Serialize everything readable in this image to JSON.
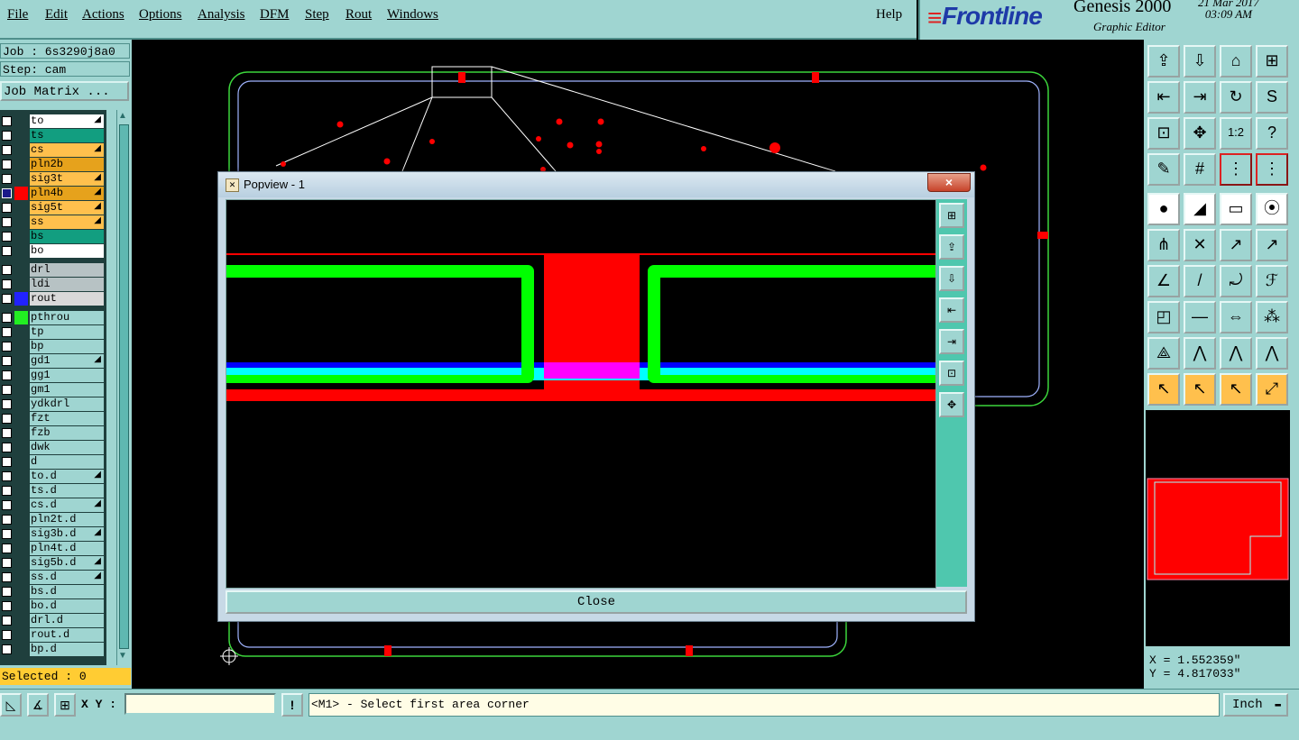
{
  "menu": {
    "items": [
      "File",
      "Edit",
      "Actions",
      "Options",
      "Analysis",
      "DFM",
      "Step",
      "Rout",
      "Windows"
    ],
    "help": "Help"
  },
  "brand": {
    "logo": "Frontline",
    "product": "Genesis 2000",
    "subtitle": "Graphic Editor",
    "date": "21 Mar 2017",
    "time": "03:09 AM"
  },
  "job": {
    "job_line": "Job : 6s3290j8a0",
    "step_line": "Step: cam",
    "matrix_button": "Job Matrix ..."
  },
  "layers": [
    {
      "name": "to",
      "bg": "#ffffff",
      "swatch": "",
      "mark": true,
      "checked": false
    },
    {
      "name": "ts",
      "bg": "#129e80",
      "swatch": "",
      "mark": false,
      "checked": false
    },
    {
      "name": "cs",
      "bg": "#ffc04d",
      "swatch": "",
      "mark": true,
      "checked": false
    },
    {
      "name": "pln2b",
      "bg": "#e6a21c",
      "swatch": "",
      "mark": false,
      "checked": false
    },
    {
      "name": "sig3t",
      "bg": "#ffc04d",
      "swatch": "",
      "mark": true,
      "checked": false
    },
    {
      "name": "pln4b",
      "bg": "#e6a21c",
      "swatch": "#ff0000",
      "mark": true,
      "checked": true
    },
    {
      "name": "sig5t",
      "bg": "#ffc04d",
      "swatch": "",
      "mark": true,
      "checked": false
    },
    {
      "name": "ss",
      "bg": "#ffc04d",
      "swatch": "",
      "mark": true,
      "checked": false
    },
    {
      "name": "bs",
      "bg": "#129e80",
      "swatch": "",
      "mark": false,
      "checked": false
    },
    {
      "name": "bo",
      "bg": "#ffffff",
      "swatch": "",
      "mark": false,
      "checked": false
    },
    {
      "name": "drl",
      "bg": "#b7c2c4",
      "swatch": "",
      "mark": false,
      "checked": false,
      "gap": true
    },
    {
      "name": "ldi",
      "bg": "#b7c2c4",
      "swatch": "",
      "mark": false,
      "checked": false
    },
    {
      "name": "rout",
      "bg": "#d9d9d9",
      "swatch": "#2222ff",
      "mark": false,
      "checked": false
    },
    {
      "name": "pthrou",
      "bg": "#9fd5d1",
      "swatch": "#22ee22",
      "mark": false,
      "checked": false,
      "gap": true
    },
    {
      "name": "tp",
      "bg": "#9fd5d1",
      "swatch": "",
      "mark": false,
      "checked": false
    },
    {
      "name": "bp",
      "bg": "#9fd5d1",
      "swatch": "",
      "mark": false,
      "checked": false
    },
    {
      "name": "gd1",
      "bg": "#9fd5d1",
      "swatch": "",
      "mark": true,
      "checked": false
    },
    {
      "name": "gg1",
      "bg": "#9fd5d1",
      "swatch": "",
      "mark": false,
      "checked": false
    },
    {
      "name": "gm1",
      "bg": "#9fd5d1",
      "swatch": "",
      "mark": false,
      "checked": false
    },
    {
      "name": "ydkdrl",
      "bg": "#9fd5d1",
      "swatch": "",
      "mark": false,
      "checked": false
    },
    {
      "name": "fzt",
      "bg": "#9fd5d1",
      "swatch": "",
      "mark": false,
      "checked": false
    },
    {
      "name": "fzb",
      "bg": "#9fd5d1",
      "swatch": "",
      "mark": false,
      "checked": false
    },
    {
      "name": "dwk",
      "bg": "#9fd5d1",
      "swatch": "",
      "mark": false,
      "checked": false
    },
    {
      "name": "d",
      "bg": "#9fd5d1",
      "swatch": "",
      "mark": false,
      "checked": false
    },
    {
      "name": "to.d",
      "bg": "#9fd5d1",
      "swatch": "",
      "mark": true,
      "checked": false
    },
    {
      "name": "ts.d",
      "bg": "#9fd5d1",
      "swatch": "",
      "mark": false,
      "checked": false
    },
    {
      "name": "cs.d",
      "bg": "#9fd5d1",
      "swatch": "",
      "mark": true,
      "checked": false
    },
    {
      "name": "pln2t.d",
      "bg": "#9fd5d1",
      "swatch": "",
      "mark": false,
      "checked": false
    },
    {
      "name": "sig3b.d",
      "bg": "#9fd5d1",
      "swatch": "",
      "mark": true,
      "checked": false
    },
    {
      "name": "pln4t.d",
      "bg": "#9fd5d1",
      "swatch": "",
      "mark": false,
      "checked": false
    },
    {
      "name": "sig5b.d",
      "bg": "#9fd5d1",
      "swatch": "",
      "mark": true,
      "checked": false
    },
    {
      "name": "ss.d",
      "bg": "#9fd5d1",
      "swatch": "",
      "mark": true,
      "checked": false
    },
    {
      "name": "bs.d",
      "bg": "#9fd5d1",
      "swatch": "",
      "mark": false,
      "checked": false
    },
    {
      "name": "bo.d",
      "bg": "#9fd5d1",
      "swatch": "",
      "mark": false,
      "checked": false
    },
    {
      "name": "drl.d",
      "bg": "#9fd5d1",
      "swatch": "",
      "mark": false,
      "checked": false
    },
    {
      "name": "rout.d",
      "bg": "#9fd5d1",
      "swatch": "",
      "mark": false,
      "checked": false
    },
    {
      "name": "bp.d",
      "bg": "#9fd5d1",
      "swatch": "",
      "mark": false,
      "checked": false
    }
  ],
  "selected": "Selected : 0",
  "toolbar": {
    "rows": [
      [
        "zoom-home-icon",
        "zoom-out-icon",
        "home-icon",
        "zoom-fit-icon"
      ],
      [
        "pan-left-icon",
        "pan-right-icon",
        "refresh-icon",
        "redraw-icon"
      ],
      [
        "zoom-frame-icon",
        "zoom-center-icon",
        "one-to-one-icon",
        "help-icon"
      ],
      [
        "measure-tool-icon",
        "grid-icon",
        "layers-left-icon",
        "layers-right-icon"
      ],
      [
        "pad-icon",
        "snap-icon",
        "ruler-icon",
        "circle-icon"
      ],
      [
        "connect-icon",
        "delete-icon",
        "move-point-icon",
        "copy-point-icon"
      ],
      [
        "line-draw-icon",
        "slash-icon",
        "rotate-icon",
        "mirror-icon"
      ],
      [
        "add-pad-icon",
        "dash-line-icon",
        "resize-icon",
        "group-icon"
      ],
      [
        "arc-icon",
        "triangle-icon",
        "polygon-icon",
        "shape-icon"
      ],
      [
        "select-arrow-icon",
        "select-box-icon",
        "select-polygon-icon",
        "select-path-icon"
      ]
    ],
    "glyphs": [
      [
        "⇪",
        "⇩",
        "⌂",
        "⊞"
      ],
      [
        "⇤",
        "⇥",
        "↻",
        "S"
      ],
      [
        "⊡",
        "✥",
        "1:2",
        "?"
      ],
      [
        "✎",
        "#",
        "⋮",
        "⋮"
      ],
      [
        "●",
        "◢",
        "▭",
        "⦿"
      ],
      [
        "⋔",
        "✕",
        "↗",
        "↗"
      ],
      [
        "∠",
        "/",
        "⤾",
        "ℱ"
      ],
      [
        "◰",
        "—",
        "⇔",
        "⁂"
      ],
      [
        "⟁",
        "⋀",
        "⋀",
        "⋀"
      ],
      [
        "↖",
        "↖",
        "↖",
        "⤢"
      ]
    ]
  },
  "coords": {
    "x": "X = 1.552359\"",
    "y": "Y = 4.817033\""
  },
  "status": {
    "xy_label": "X Y :",
    "xy_value": "",
    "alert_glyph": "!",
    "prompt": "<M1> - Select first area corner",
    "units": "Inch"
  },
  "popview": {
    "title": "Popview - 1",
    "close_x": "×",
    "close_button": "Close"
  },
  "colors": {
    "panel": "#9fd5d1",
    "board_outline": "#3cd63c",
    "pad": "#ff0000",
    "trace": "#00ff00",
    "cyan_layer": "#00ffff",
    "blue_layer": "#0000ff",
    "magenta": "#ff00ff"
  }
}
